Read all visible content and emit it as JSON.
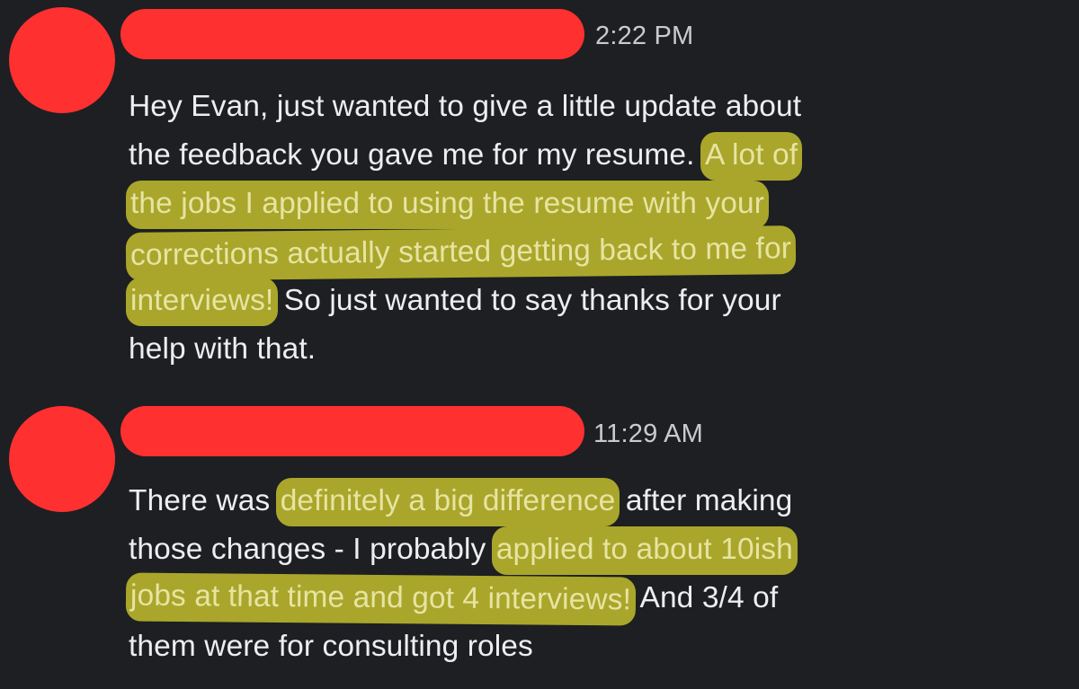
{
  "messages": [
    {
      "timestamp": "2:22 PM",
      "lines": [
        {
          "segments": [
            {
              "text": "Hey Evan, just wanted to give a little update about",
              "highlight": false
            }
          ]
        },
        {
          "segments": [
            {
              "text": "the feedback you gave me for my resume. ",
              "highlight": false
            },
            {
              "text": "A lot of",
              "highlight": true
            }
          ]
        },
        {
          "segments": [
            {
              "text": "the jobs I applied to using the resume with your",
              "highlight": true
            }
          ]
        },
        {
          "segments": [
            {
              "text": "corrections actually started getting back to me for",
              "highlight": true
            }
          ]
        },
        {
          "segments": [
            {
              "text": "interviews!",
              "highlight": true
            },
            {
              "text": " So just wanted to say thanks for your",
              "highlight": false
            }
          ]
        },
        {
          "segments": [
            {
              "text": "help with that.",
              "highlight": false
            }
          ]
        }
      ]
    },
    {
      "timestamp": "11:29 AM",
      "lines": [
        {
          "segments": [
            {
              "text": "There was ",
              "highlight": false
            },
            {
              "text": "definitely a big difference",
              "highlight": true
            },
            {
              "text": " after making",
              "highlight": false
            }
          ]
        },
        {
          "segments": [
            {
              "text": "those changes - I probably ",
              "highlight": false
            },
            {
              "text": "applied to about 10ish",
              "highlight": true
            }
          ]
        },
        {
          "segments": [
            {
              "text": "jobs at that time and got 4 interviews!",
              "highlight": true
            },
            {
              "text": " And 3/4 of",
              "highlight": false
            }
          ]
        },
        {
          "segments": [
            {
              "text": "them were for consulting roles",
              "highlight": false
            }
          ]
        }
      ]
    }
  ],
  "colors": {
    "background": "#1d1f23",
    "redaction": "#ff3030",
    "highlight": "#a9a62b",
    "text": "#eceef0"
  }
}
